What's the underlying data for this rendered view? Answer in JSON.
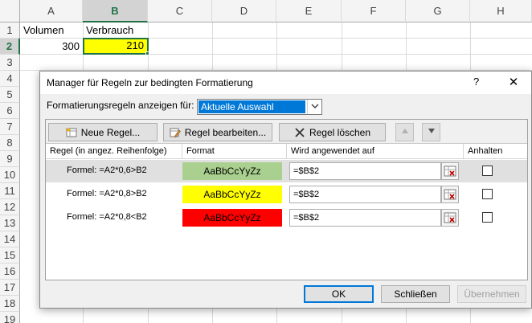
{
  "sheet": {
    "columns": [
      "A",
      "B",
      "C",
      "D",
      "E",
      "F",
      "G",
      "H"
    ],
    "selected_column": "B",
    "rows": [
      "1",
      "2",
      "3",
      "4",
      "5",
      "6",
      "7",
      "8",
      "9",
      "10",
      "11",
      "12",
      "13",
      "14",
      "15",
      "16",
      "17",
      "18",
      "19"
    ],
    "selected_row": "2",
    "cells": {
      "A1": "Volumen",
      "B1": "Verbrauch",
      "A2": "300",
      "B2": "210"
    },
    "active_cell_fill": "#ffff00"
  },
  "dialog": {
    "title": "Manager für Regeln zur bedingten Formatierung",
    "help": "?",
    "close": "✕",
    "show_for_label": "Formatierungsregeln anzeigen für:",
    "show_for_value": "Aktuelle Auswahl",
    "toolbar": {
      "new_rule": "Neue Regel...",
      "edit_rule": "Regel bearbeiten...",
      "delete_rule": "Regel löschen",
      "move_up_icon": "triangle-up-icon",
      "move_down_icon": "triangle-down-icon"
    },
    "columns": {
      "rule": "Regel (in angez. Reihenfolge)",
      "format": "Format",
      "applies_to": "Wird angewendet auf",
      "stop": "Anhalten"
    },
    "rules": [
      {
        "formula": "Formel: =A2*0,6>B2",
        "preview": "AaBbCcYyZz",
        "fill": "#a9d08e",
        "text_color": "#000000",
        "applies_to": "=$B$2",
        "stop": false
      },
      {
        "formula": "Formel: =A2*0,8>B2",
        "preview": "AaBbCcYyZz",
        "fill": "#ffff00",
        "text_color": "#000000",
        "applies_to": "=$B$2",
        "stop": false
      },
      {
        "formula": "Formel: =A2*0,8<B2",
        "preview": "AaBbCcYyZz",
        "fill": "#ff0000",
        "text_color": "#000000",
        "applies_to": "=$B$2",
        "stop": false
      }
    ],
    "buttons": {
      "ok": "OK",
      "close": "Schließen",
      "apply": "Übernehmen"
    }
  }
}
